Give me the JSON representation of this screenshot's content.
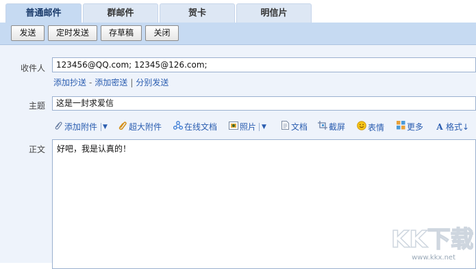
{
  "tabs": [
    {
      "label": "普通邮件",
      "active": true
    },
    {
      "label": "群邮件",
      "active": false
    },
    {
      "label": "贺卡",
      "active": false
    },
    {
      "label": "明信片",
      "active": false
    }
  ],
  "toolbar": {
    "send": "发送",
    "timed_send": "定时发送",
    "save_draft": "存草稿",
    "close": "关闭"
  },
  "compose": {
    "to_label": "收件人",
    "to_value": "123456@QQ.com;  12345@126.com;",
    "links": {
      "add_cc": "添加抄送",
      "dash": "-",
      "add_bcc": "添加密送",
      "pipe": "|",
      "separate_send": "分别发送"
    },
    "subject_label": "主题",
    "subject_value": "这是一封求爱信",
    "tools": {
      "attach": "添加附件",
      "big_attach": "超大附件",
      "online_doc": "在线文档",
      "photo": "照片",
      "document": "文档",
      "screenshot": "截屏",
      "emoji": "表情",
      "more": "更多",
      "format": "格式"
    },
    "body_label": "正文",
    "body_value": "好吧，我是认真的！"
  },
  "watermark": {
    "logo_text": "KK下载",
    "url": "www.kkx.net"
  },
  "colors": {
    "toolbar_bg": "#c6daf2",
    "form_bg": "#eef3fb",
    "link": "#2a5db0"
  }
}
